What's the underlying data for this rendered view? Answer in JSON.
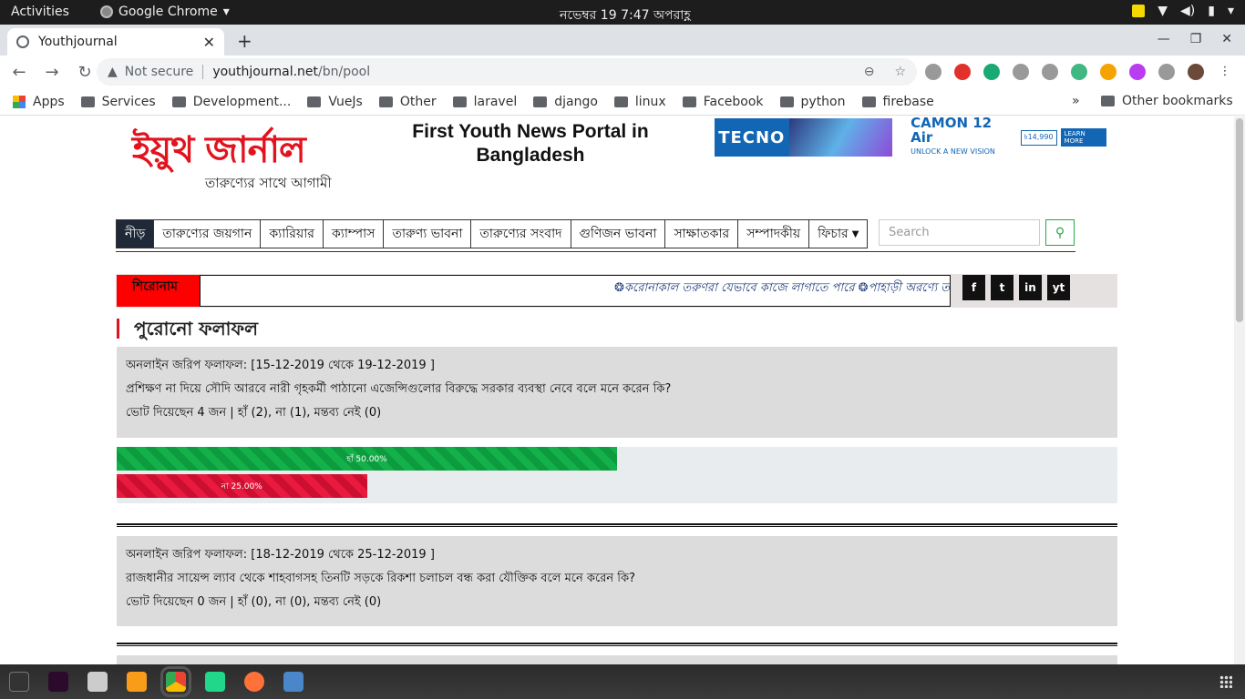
{
  "topbar": {
    "activities": "Activities",
    "app_name": "Google Chrome",
    "clock": "নভেম্বর 19   7:47 অপরাহ্ণ"
  },
  "tabs": [
    {
      "title": "Youthjournal"
    }
  ],
  "omnibox": {
    "security": "Not secure",
    "url_host": "youthjournal.net",
    "url_path": "/bn/pool"
  },
  "bookmarks": {
    "items": [
      "Apps",
      "Services",
      "Development...",
      "VueJs",
      "Other",
      "laravel",
      "django",
      "linux",
      "Facebook",
      "python",
      "firebase"
    ],
    "more": "»",
    "other": "Other bookmarks"
  },
  "site": {
    "logo_main": "ইয়ুথ জার্নাল",
    "logo_sub": "তারুণ্যের সাথে আগামী",
    "tagline": "First Youth News Portal in Bangladesh",
    "banner": {
      "brand": "TECNO",
      "model": "CAMON 12 Air",
      "sub": "UNLOCK A NEW VISION",
      "price": "৳14,990",
      "cta": "LEARN MORE"
    }
  },
  "nav": {
    "items": [
      "নীড়",
      "তারুণ্যের জয়গান",
      "ক্যারিয়ার",
      "ক্যাম্পাস",
      "তারুণ্য ভাবনা",
      "তারুণ্যের সংবাদ",
      "গুণিজন ভাবনা",
      "সাক্ষাতকার",
      "সম্পাদকীয়",
      "ফিচার"
    ],
    "search_placeholder": "Search"
  },
  "ticker": {
    "label": "শিরোনাম",
    "text": "❂করোনাকাল তরুণরা যেভাবে কাজে লাগাতে পারে ❂পাহাড়ী অরণ্যে তার"
  },
  "social": [
    "f",
    "t",
    "in",
    "yt"
  ],
  "section_title": "পুরোনো ফলাফল",
  "polls": [
    {
      "title": "অনলাইন জরিপ ফলাফল: [15-12-2019 থেকে 19-12-2019 ]",
      "question": "প্রশিক্ষণ না দিয়ে সৌদি আরবে নারী গৃহকর্মী পাঠানো এজেন্সিগুলোর বিরুদ্ধে সরকার ব্যবস্থা নেবে বলে মনে করেন কি?",
      "summary": "ভোট দিয়েছেন 4 জন | হাঁ (2), না (1), মন্তব্য নেই (0)",
      "bars": [
        {
          "label": "হাঁ 50.00%",
          "percent": 50
        },
        {
          "label": "না 25.00%",
          "percent": 25
        }
      ]
    },
    {
      "title": "অনলাইন জরিপ ফলাফল: [18-12-2019 থেকে 25-12-2019 ]",
      "question": "রাজধানীর সায়েন্স ল্যাব থেকে শাহবাগসহ তিনটি সড়কে রিকশা চলাচল বন্ধ করা যৌক্তিক বলে মনে করেন কি?",
      "summary": "ভোট দিয়েছেন 0 জন | হাঁ (0), না (0), মন্তব্য নেই (0)"
    }
  ],
  "colors": {
    "brand_red": "#e2131f",
    "yes": "#14b04a",
    "no": "#e81a3e"
  }
}
